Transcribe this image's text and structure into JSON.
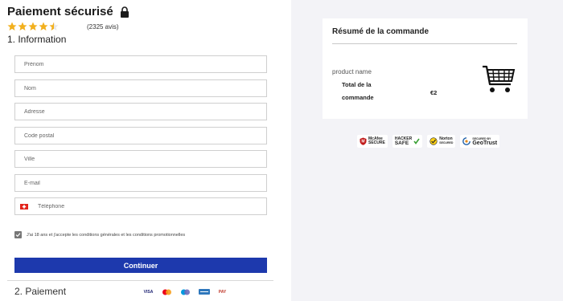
{
  "header": {
    "title": "Paiement sécurisé",
    "reviews": "(2325 avis)",
    "rating": 4.5
  },
  "information": {
    "title": "1. Information",
    "fields": [
      {
        "name": "prenom",
        "placeholder": "Prénom"
      },
      {
        "name": "nom",
        "placeholder": "Nom"
      },
      {
        "name": "adresse",
        "placeholder": "Adresse"
      },
      {
        "name": "code-postal",
        "placeholder": "Code postal"
      },
      {
        "name": "ville",
        "placeholder": "Ville"
      },
      {
        "name": "email",
        "placeholder": "E-mail"
      },
      {
        "name": "telephone",
        "placeholder": "Téléphone"
      }
    ],
    "consent": "J'ai 18 ans et j'accepte les conditions générales et les conditions promotionnelles",
    "continue_label": "Continuer"
  },
  "payment": {
    "title": "2. Paiement",
    "cards": [
      "VISA",
      "MC",
      "MAE",
      "PAY"
    ]
  },
  "summary": {
    "title": "Résumé de la commande",
    "product_name": "product name",
    "total_label": "Total de la commande",
    "total_value": "€2"
  },
  "trust_badges": [
    {
      "name": "mcafee",
      "line1": "McAfee",
      "line2": "SECURE"
    },
    {
      "name": "hacker-safe",
      "line1": "HACKER",
      "line2": "SAFE"
    },
    {
      "name": "norton",
      "line1": "Norton",
      "line2": "SECURED"
    },
    {
      "name": "geotrust",
      "line1": "SECURED BY",
      "line2": "GeoTrust"
    }
  ],
  "colors": {
    "accent": "#1d39ad",
    "star": "#f2b01e",
    "panel_bg": "#f3f3f7"
  }
}
